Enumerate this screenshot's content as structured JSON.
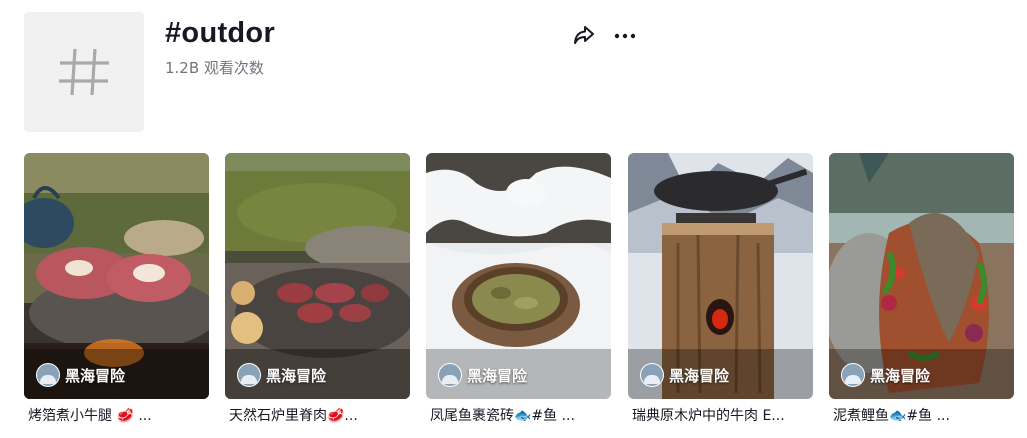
{
  "tag": {
    "title": "#outdor",
    "views": "1.2B 观看次数",
    "avatar_icon": "hashtag-icon"
  },
  "actions": {
    "share_icon": "share-icon",
    "more_icon": "more-horizontal-icon"
  },
  "videos": [
    {
      "author": "黑海冒险",
      "caption": "烤箔煮小牛腿 🥩 ..."
    },
    {
      "author": "黑海冒险",
      "caption": "天然石炉里脊肉🥩..."
    },
    {
      "author": "黑海冒险",
      "caption": "凤尾鱼裹瓷砖🐟#鱼 ..."
    },
    {
      "author": "黑海冒险",
      "caption": "瑞典原木炉中的牛肉 E..."
    },
    {
      "author": "黑海冒险",
      "caption": "泥煮鲤鱼🐟#鱼 ..."
    }
  ],
  "colors": {
    "text_primary": "#161823",
    "text_secondary": "#73747b",
    "avatar_bg": "#f1f1f2"
  }
}
